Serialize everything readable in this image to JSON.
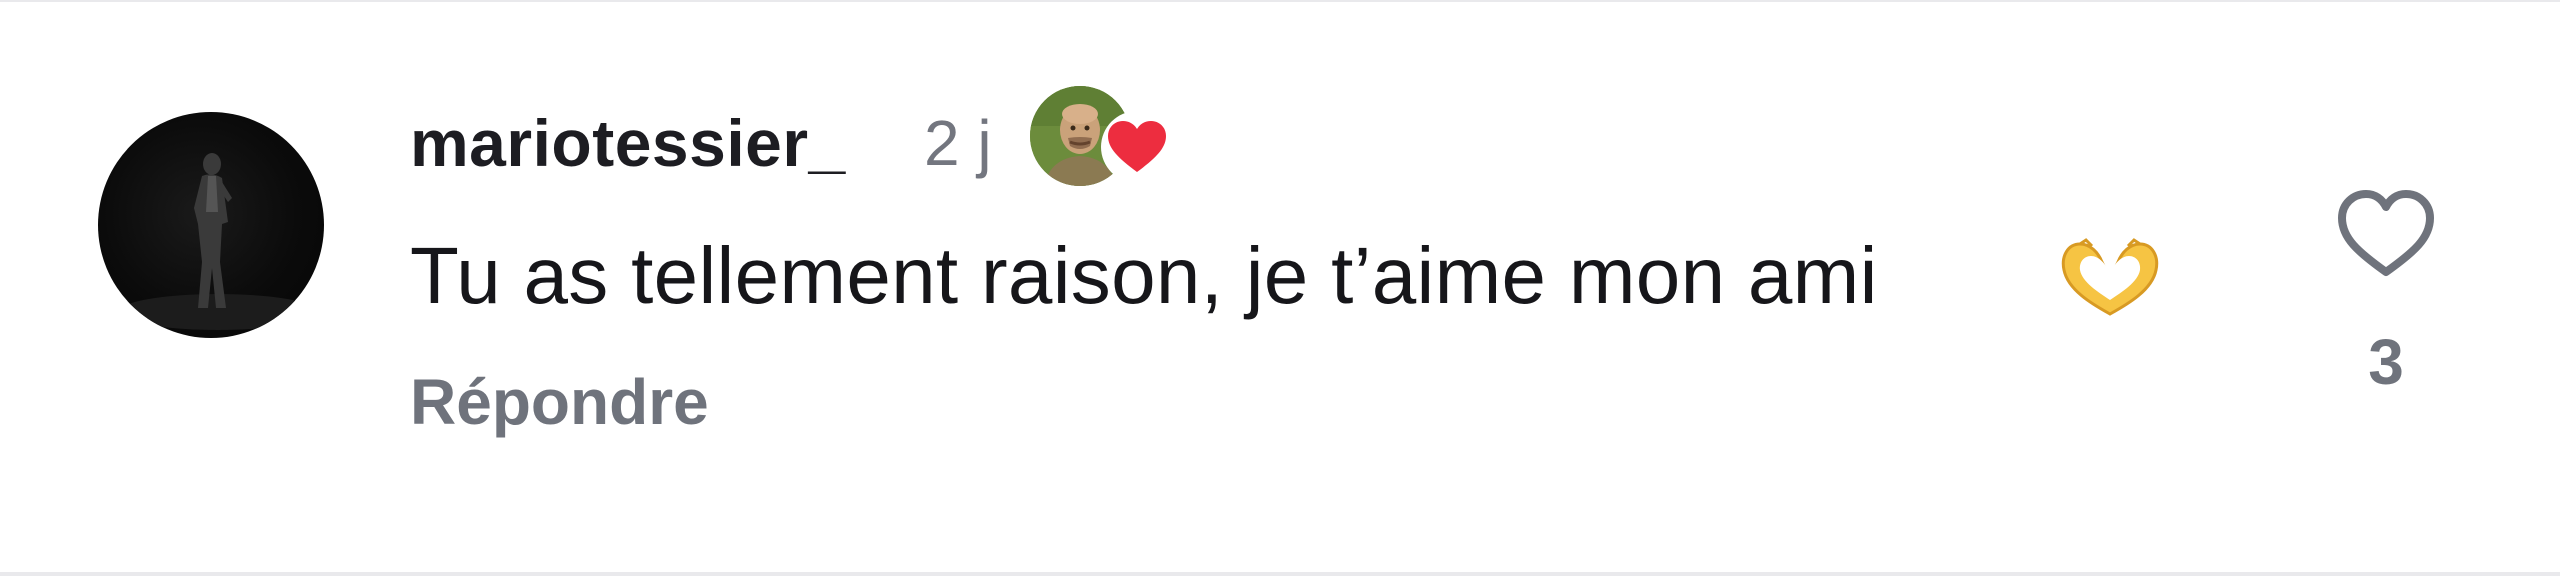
{
  "comment": {
    "username": "mariotessier_",
    "timestamp": "2 j",
    "text": "Tu as tellement raison, je t’aime mon ami",
    "emoji_icon": "heart-hands-emoji",
    "reply_label": "Répondre",
    "like_count": "3",
    "liked_by_author": true
  },
  "icons": {
    "avatar": "user-avatar",
    "author_like": "author-avatar-with-heart",
    "like": "heart-outline-icon"
  },
  "colors": {
    "text_primary": "#1d1d22",
    "text_secondary": "#73767f",
    "heart_red": "#ed2d3f",
    "emoji_yellow": "#f6c443"
  }
}
